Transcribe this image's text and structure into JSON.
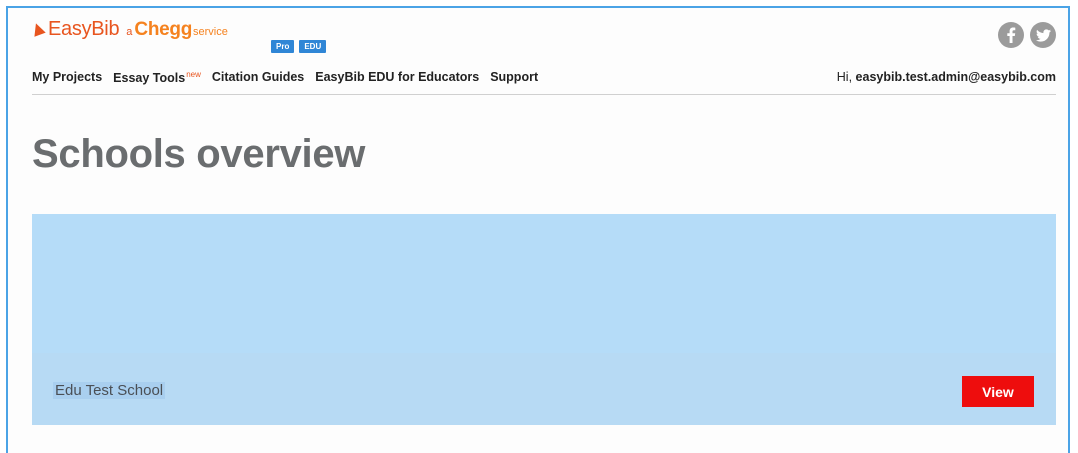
{
  "brand": {
    "easybib": "EasyBib",
    "a": "a",
    "chegg": "Chegg",
    "service": "service",
    "badges": [
      "Pro",
      "EDU"
    ],
    "colors": {
      "easybib_orange": "#e8551f",
      "chegg_orange": "#f5821f",
      "badge_blue": "#2f86d6"
    }
  },
  "social": {
    "icons": [
      "facebook-icon",
      "twitter-icon"
    ]
  },
  "nav": {
    "items": [
      {
        "label": "My Projects"
      },
      {
        "label": "Essay Tools",
        "badge": "new"
      },
      {
        "label": "Citation Guides"
      },
      {
        "label": "EasyBib EDU for Educators"
      },
      {
        "label": "Support"
      }
    ],
    "greeting_prefix": "Hi,",
    "user_email": "easybib.test.admin@easybib.com"
  },
  "page": {
    "title": "Schools overview"
  },
  "schools": [
    {
      "name": "Edu Test School",
      "action_label": "View",
      "action_color": "#ee0d0d",
      "card_color": "#b5dcf8"
    }
  ]
}
